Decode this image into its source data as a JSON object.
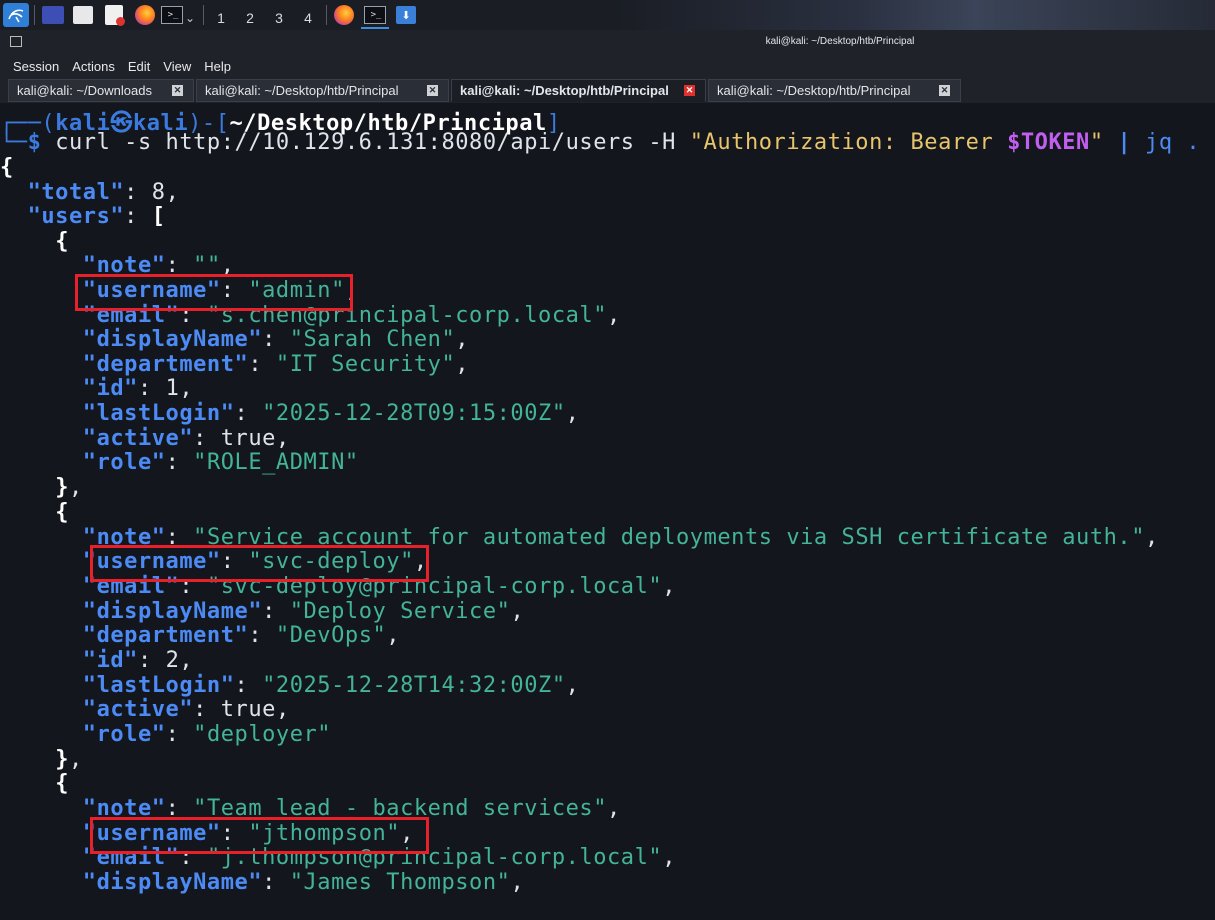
{
  "taskbar": {
    "workspaces": [
      "1",
      "2",
      "3",
      "4"
    ],
    "active_workspace": "1",
    "icons": [
      "kali-menu-icon",
      "desktop-icon",
      "file-manager-icon",
      "text-editor-icon",
      "firefox-icon",
      "terminal-icon",
      "firefox-icon",
      "terminal-icon",
      "download-icon"
    ]
  },
  "window": {
    "title": "kali@kali: ~/Desktop/htb/Principal"
  },
  "menu": [
    "Session",
    "Actions",
    "Edit",
    "View",
    "Help"
  ],
  "tabs": [
    {
      "label": "kali@kali: ~/Downloads",
      "active": false
    },
    {
      "label": "kali@kali: ~/Desktop/htb/Principal",
      "active": false
    },
    {
      "label": "kali@kali: ~/Desktop/htb/Principal",
      "active": true
    },
    {
      "label": "kali@kali: ~/Desktop/htb/Principal",
      "active": false
    }
  ],
  "prompt": {
    "user": "kali",
    "host": "kali",
    "path": "~/Desktop/htb/Principal",
    "cmd_curl": "curl -s http://10.129.6.131:8080/api/users -H ",
    "cmd_header_a": "\"Authorization: Bearer ",
    "cmd_var": "$TOKEN",
    "cmd_header_b": "\"",
    "cmd_pipe": "|",
    "cmd_jq": "jq ."
  },
  "output": {
    "total": "8",
    "users": [
      {
        "note": "\"\"",
        "username": "\"admin\"",
        "email": "\"s.chen@principal-corp.local\"",
        "displayName": "\"Sarah Chen\"",
        "department": "\"IT Security\"",
        "id": "1",
        "lastLogin": "\"2025-12-28T09:15:00Z\"",
        "active": "true",
        "role": "\"ROLE_ADMIN\""
      },
      {
        "note": "\"Service account for automated deployments via SSH certificate auth.\"",
        "username": "\"svc-deploy\"",
        "email": "\"svc-deploy@principal-corp.local\"",
        "displayName": "\"Deploy Service\"",
        "department": "\"DevOps\"",
        "id": "2",
        "lastLogin": "\"2025-12-28T14:32:00Z\"",
        "active": "true",
        "role": "\"deployer\""
      },
      {
        "note": "\"Team lead - backend services\"",
        "username": "\"jthompson\"",
        "email": "\"j.thompson@principal-corp.local\"",
        "displayName": "\"James Thompson\""
      }
    ]
  },
  "colors": {
    "json_key": "#4c8bf5",
    "json_string": "#43b39a",
    "highlight_box": "#e8202a",
    "terminal_bg": "#13161c"
  }
}
